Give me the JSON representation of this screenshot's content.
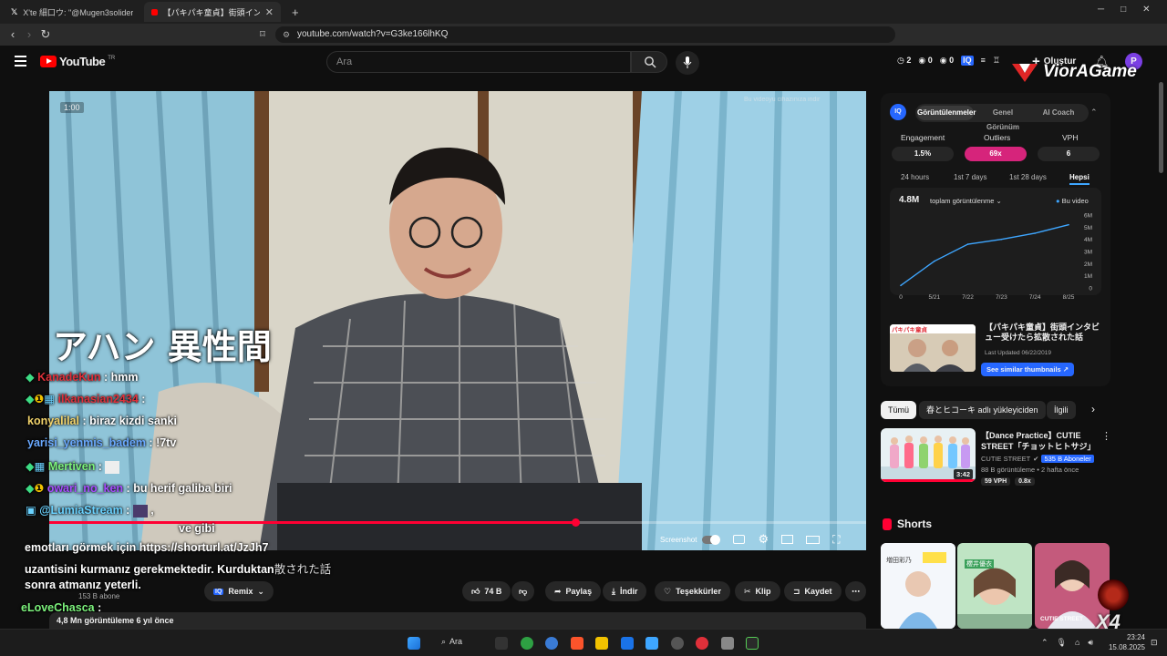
{
  "browser": {
    "tabs": [
      {
        "label": "X'te 細口ウ: \"@Mugen3solider ここ部",
        "active": false
      },
      {
        "label": "【パキパキ童貞】街頭インタビュー受け",
        "active": true
      }
    ],
    "url": "youtube.com/watch?v=G3ke166lhKQ"
  },
  "youtube": {
    "logo_text": "YouTube",
    "logo_region": "TR",
    "search_placeholder": "Ara",
    "header_stats": {
      "a": "2",
      "b": "0",
      "c": "0"
    },
    "create_label": "Oluştur",
    "avatar_letter": "P"
  },
  "watermark": {
    "brand": "ViorAGame"
  },
  "video": {
    "timer": "1:00",
    "top_right_hint": "Bu videoyu cihazınıza indir",
    "caption": "アハン 異性間",
    "screenshot_label": "Screenshot"
  },
  "chat": [
    {
      "user": "KanadeKun",
      "sep": " : ",
      "msg": "hmm",
      "color": "#e0303a"
    },
    {
      "user": "ilkanasian2434",
      "sep": " :",
      "msg": "",
      "color": "#e0303a"
    },
    {
      "user": "konyalilal",
      "sep": " : ",
      "msg": "biraz kizdi sanki",
      "color": "#f2d36b"
    },
    {
      "user": "yarisi_yenmis_badem",
      "sep": " : ",
      "msg": "!7tv",
      "color": "#6aa9ff"
    },
    {
      "user": "Mertiven",
      "sep": " : ",
      "msg": "",
      "color": "#7cf27c"
    },
    {
      "user": "owari_no_ken",
      "sep": " : ",
      "msg": "bu herif galiba biri",
      "color": "#a64dff"
    },
    {
      "user": "@LumiaStream",
      "sep": " : ",
      "msg": ",",
      "color": "#6ad2ff"
    },
    {
      "user": "",
      "sep": "",
      "msg": "ve      gibi",
      "color": "#ffffff"
    },
    {
      "user": "",
      "sep": "",
      "msg": "emotları görmek için https://shorturl.at/JzJh7",
      "color": "#ffffff"
    },
    {
      "user": "",
      "sep": "",
      "msg": "uzantisini kurmanız gerekmektedir. Kurduktan",
      "color": "#ffffff"
    },
    {
      "user": "",
      "sep": "",
      "msg": "sonra      atmanız yeterli.",
      "color": "#ffffff"
    },
    {
      "user": "eLoveChasca",
      "sep": " :",
      "msg": "",
      "color": "#7cf27c"
    }
  ],
  "below_video": {
    "behind_text": "散された話",
    "subs": "153 B abone",
    "views_date": "4,8 Mn görüntüleme  6 yıl önce",
    "buttons": {
      "remix": "Remix",
      "likes": "74 B",
      "share": "Paylaş",
      "download": "İndir",
      "thanks": "Teşekkürler",
      "clip": "Klip",
      "save": "Kaydet"
    }
  },
  "panel": {
    "tabs": [
      "Görüntülenmeler",
      "Genel Görünüm",
      "AI Coach"
    ],
    "metrics": [
      {
        "label": "Engagement",
        "value": "1.5%"
      },
      {
        "label": "Outliers",
        "value": "69x"
      },
      {
        "label": "VPH",
        "value": "6"
      }
    ],
    "ranges": [
      "24 hours",
      "1st 7 days",
      "1st 28 days",
      "Hepsi"
    ],
    "total_views": "4.8M",
    "total_label": "toplam görüntülenme",
    "legend": "Bu video",
    "thumb_title": "【パキパキ童貞】街頭インタビュー受けたら拡散された話",
    "last_updated": "Last Updated 06/22/2019",
    "similar_btn": "See similar thumbnails",
    "thumb_text": "パキパキ童貞"
  },
  "chart_data": {
    "type": "line",
    "x": [
      "0",
      "5/21",
      "7/22",
      "7/23",
      "7/24",
      "8/25"
    ],
    "yticks": [
      "0",
      "1M",
      "2M",
      "3M",
      "4M",
      "5M",
      "6M"
    ],
    "ylim": [
      0,
      6
    ],
    "series": [
      {
        "name": "Bu video",
        "values": [
          0.2,
          2.2,
          3.6,
          4.0,
          4.5,
          5.2
        ]
      }
    ],
    "line_color": "#3ea6ff"
  },
  "chips": [
    "Tümü",
    "春とヒコーキ adlı yükleyiciden",
    "İlgili"
  ],
  "recommended": {
    "title": "【Dance Practice】CUTIE STREET「チョットヒトサジ」",
    "channel": "CUTIE STREET",
    "channel_subs": "535 B Aboneler",
    "meta": "88 B görüntüleme • 2 hafta önce",
    "duration": "3:42",
    "badge_vph": "59 VPH",
    "badge_x": "0.8x"
  },
  "shorts": {
    "label": "Shorts",
    "cards": [
      {
        "caption": "増田彩乃"
      },
      {
        "caption": "櫻井優衣"
      },
      {
        "caption": "CUTIE STREET"
      }
    ]
  },
  "taskbar": {
    "search": "Ara",
    "time": "23:24",
    "date": "15.08.2025",
    "overlay_badge": "X4"
  }
}
